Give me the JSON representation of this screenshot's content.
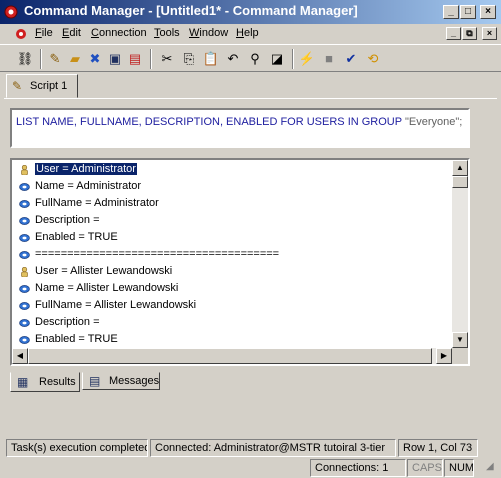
{
  "window": {
    "title": "Command Manager - [Untitled1* - Command Manager]",
    "app_icon": "gear-icon",
    "controls": [
      "minimize-icon",
      "maximize-icon",
      "close-icon"
    ]
  },
  "menu": {
    "items": [
      {
        "label": "File",
        "mnemonic": "F"
      },
      {
        "label": "Edit",
        "mnemonic": "E"
      },
      {
        "label": "Connection",
        "mnemonic": "C"
      },
      {
        "label": "Tools",
        "mnemonic": "T"
      },
      {
        "label": "Window",
        "mnemonic": "W"
      },
      {
        "label": "Help",
        "mnemonic": "H"
      }
    ],
    "mdi_controls": [
      "minimize-icon",
      "restore-icon",
      "close-icon"
    ]
  },
  "toolbar": {
    "buttons": [
      "connect-icon",
      "new-script-icon",
      "open-icon",
      "disconnect-icon",
      "save-icon",
      "save-results-icon",
      "cut-icon",
      "copy-icon",
      "paste-icon",
      "undo-icon",
      "find-icon",
      "edit-icon",
      "execute-icon",
      "stop-icon",
      "check-syntax-icon",
      "reconnect-icon"
    ]
  },
  "tabs": {
    "script_tab": "Script 1"
  },
  "query": {
    "command": "LIST NAME, FULLNAME, DESCRIPTION, ENABLED FOR USERS IN GROUP",
    "argument": "\"Everyone\";"
  },
  "results": {
    "rows": [
      {
        "icon": "user-icon",
        "text": "User = Administrator",
        "selected": true
      },
      {
        "icon": "property-icon",
        "text": "Name = Administrator"
      },
      {
        "icon": "property-icon",
        "text": "FullName = Administrator"
      },
      {
        "icon": "property-icon",
        "text": "Description ="
      },
      {
        "icon": "property-icon",
        "text": "Enabled = TRUE"
      },
      {
        "icon": "property-icon",
        "text": "======================================"
      },
      {
        "icon": "user-icon",
        "text": "User = Allister Lewandowski"
      },
      {
        "icon": "property-icon",
        "text": "Name = Allister Lewandowski"
      },
      {
        "icon": "property-icon",
        "text": "FullName = Allister Lewandowski"
      },
      {
        "icon": "property-icon",
        "text": "Description ="
      },
      {
        "icon": "property-icon",
        "text": "Enabled = TRUE"
      }
    ]
  },
  "bottom_tabs": {
    "results": "Results",
    "messages": "Messages"
  },
  "status": {
    "message": "Task(s) execution completed",
    "connection": "Connected: Administrator@MSTR tutoiral 3-tier",
    "position": "Row 1, Col 73",
    "connections": "Connections: 1",
    "caps": "CAPS",
    "num": "NUM"
  },
  "colors": {
    "titlebar_start": "#0a246a",
    "titlebar_end": "#a6caf0",
    "query_text": "#2020a0",
    "selection": "#0a246a"
  }
}
